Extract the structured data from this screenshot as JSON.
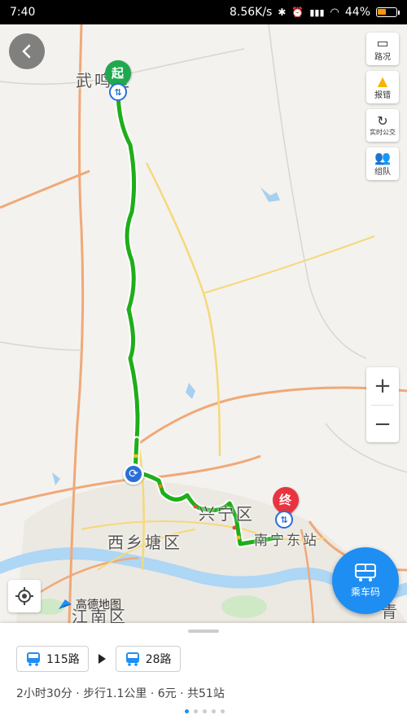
{
  "status_bar": {
    "time": "7:40",
    "network_speed": "8.56K/s",
    "battery": "44%",
    "battery_level": 0.44
  },
  "map": {
    "labels": {
      "wuming": "武鸣区",
      "xixiangtang": "西乡塘区",
      "xingning": "兴宁区",
      "nanning_east": "南宁东站",
      "jiangnan": "江南区",
      "qingxiu": "青秀"
    },
    "start_marker": "起",
    "end_marker": "终",
    "logo_text": "高德地图"
  },
  "toolbar": {
    "traffic": "路况",
    "report": "报错",
    "realtime_bus": "实时公交",
    "team": "组队",
    "zoom_in": "+",
    "zoom_out": "−"
  },
  "ride_code": {
    "label": "乘车码"
  },
  "route": {
    "legs": [
      {
        "name": "115路"
      },
      {
        "name": "28路"
      }
    ],
    "duration": "2小时30分",
    "walk": "步行1.1公里",
    "fare": "6元",
    "stops": "共51站",
    "separator": "·",
    "page_count": 5,
    "current_page": 1
  },
  "colors": {
    "route_green": "#1fae19",
    "accent_blue": "#1e8ef2",
    "end_red": "#e8343e",
    "start_green": "#20a84e"
  }
}
